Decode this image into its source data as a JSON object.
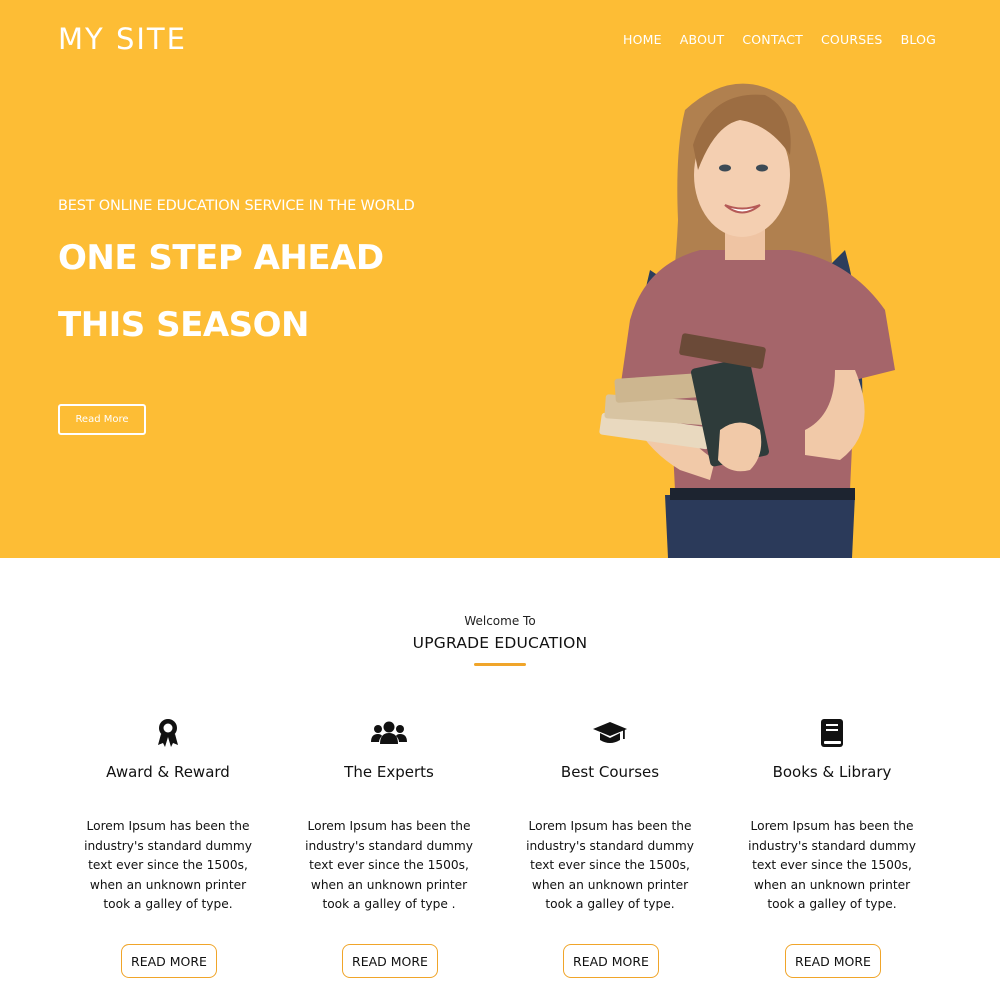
{
  "header": {
    "logo": "MY SITE",
    "nav": [
      "HOME",
      "ABOUT",
      "CONTACT",
      "COURSES",
      "BLOG"
    ]
  },
  "hero": {
    "tagline": "BEST ONLINE EDUCATION SERVICE IN THE WORLD",
    "headline_line1": "ONE STEP AHEAD",
    "headline_line2": "THIS SEASON",
    "button_label": "Read More",
    "image": "student-holding-books"
  },
  "intro": {
    "welcome": "Welcome To",
    "title": "UPGRADE EDUCATION"
  },
  "features": [
    {
      "icon": "award-icon",
      "title": "Award & Reward",
      "text": "Lorem Ipsum has been the industry's standard dummy text ever since the 1500s, when an unknown printer took a galley of type.",
      "button": "READ MORE"
    },
    {
      "icon": "users-icon",
      "title": "The Experts",
      "text": "Lorem Ipsum has been the industry's standard dummy text ever since the 1500s, when an unknown printer took a galley of type .",
      "button": "READ MORE"
    },
    {
      "icon": "graduation-cap-icon",
      "title": "Best Courses",
      "text": "Lorem Ipsum has been the industry's standard dummy text ever since the 1500s, when an unknown printer took a galley of type.",
      "button": "READ MORE"
    },
    {
      "icon": "book-icon",
      "title": "Books & Library",
      "text": "Lorem Ipsum has been the industry's standard dummy text ever since the 1500s, when an unknown printer took a galley of type.",
      "button": "READ MORE"
    }
  ],
  "colors": {
    "hero_background": "#fdbd35",
    "accent": "#f0a52a",
    "text": "#111111"
  }
}
